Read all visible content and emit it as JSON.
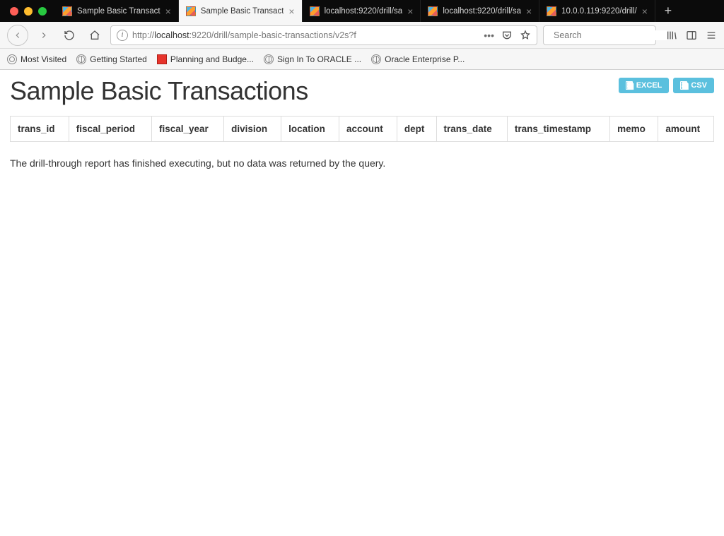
{
  "tabs": [
    {
      "title": "Sample Basic Transact",
      "active": false
    },
    {
      "title": "Sample Basic Transact",
      "active": true
    },
    {
      "title": "localhost:9220/drill/sa",
      "active": false
    },
    {
      "title": "localhost:9220/drill/sa",
      "active": false
    },
    {
      "title": "10.0.0.119:9220/drill/",
      "active": false
    }
  ],
  "url": {
    "scheme": "http://",
    "host": "localhost",
    "rest": ":9220/drill/sample-basic-transactions/v2s?f"
  },
  "search": {
    "placeholder": "Search"
  },
  "bookmarks": [
    {
      "kind": "cog",
      "label": "Most Visited"
    },
    {
      "kind": "globe",
      "label": "Getting Started"
    },
    {
      "kind": "square",
      "label": "Planning and Budge..."
    },
    {
      "kind": "globe",
      "label": "Sign In To ORACLE ..."
    },
    {
      "kind": "globe",
      "label": "Oracle Enterprise P..."
    }
  ],
  "page": {
    "title": "Sample Basic Transactions",
    "buttons": {
      "excel": "EXCEL",
      "csv": "CSV"
    },
    "columns": [
      "trans_id",
      "fiscal_period",
      "fiscal_year",
      "division",
      "location",
      "account",
      "dept",
      "trans_date",
      "trans_timestamp",
      "memo",
      "amount"
    ],
    "status": "The drill-through report has finished executing, but no data was returned by the query."
  }
}
